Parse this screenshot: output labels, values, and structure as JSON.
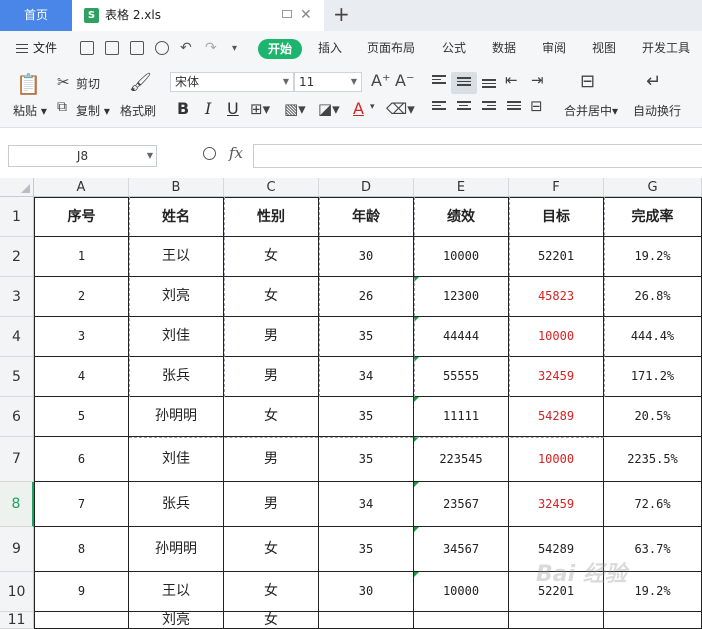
{
  "tabs": {
    "home": "首页",
    "file_name": "表格 2.xls",
    "file_icon": "S",
    "add": "+"
  },
  "menu": {
    "file": "文件",
    "items": [
      "开始",
      "插入",
      "页面布局",
      "公式",
      "数据",
      "审阅",
      "视图",
      "开发工具"
    ],
    "active_index": 0
  },
  "ribbon": {
    "paste": "粘贴",
    "cut": "剪切",
    "copy": "复制",
    "format_painter": "格式刷",
    "font_name": "宋体",
    "font_size": "11",
    "merge_center": "合并居中",
    "auto_wrap": "自动换行",
    "bold": "B",
    "italic": "I",
    "underline": "U",
    "font_color_glyph": "A"
  },
  "formula_bar": {
    "cell_ref": "J8",
    "fx": "fx",
    "value": ""
  },
  "grid": {
    "columns": [
      "A",
      "B",
      "C",
      "D",
      "E",
      "F",
      "G"
    ],
    "row_numbers": [
      "1",
      "2",
      "3",
      "4",
      "5",
      "6",
      "7",
      "8",
      "9",
      "10",
      "11"
    ],
    "selected_row": "8",
    "header_row": [
      "序号",
      "姓名",
      "性别",
      "年龄",
      "绩效",
      "目标",
      "完成率"
    ],
    "rows": [
      [
        "1",
        "王以",
        "女",
        "30",
        "10000",
        "52201",
        "19.2%"
      ],
      [
        "2",
        "刘亮",
        "女",
        "26",
        "12300",
        "45823",
        "26.8%"
      ],
      [
        "3",
        "刘佳",
        "男",
        "35",
        "44444",
        "10000",
        "444.4%"
      ],
      [
        "4",
        "张兵",
        "男",
        "34",
        "55555",
        "32459",
        "171.2%"
      ],
      [
        "5",
        "孙明明",
        "女",
        "35",
        "11111",
        "54289",
        "20.5%"
      ],
      [
        "6",
        "刘佳",
        "男",
        "35",
        "223545",
        "10000",
        "2235.5%"
      ],
      [
        "7",
        "张兵",
        "男",
        "34",
        "23567",
        "32459",
        "72.6%"
      ],
      [
        "8",
        "孙明明",
        "女",
        "35",
        "34567",
        "54289",
        "63.7%"
      ],
      [
        "9",
        "王以",
        "女",
        "30",
        "10000",
        "52201",
        "19.2%"
      ],
      [
        "",
        "刘亮",
        "女",
        "",
        "",
        "",
        ""
      ]
    ],
    "red_target_rows": [
      2,
      3,
      4,
      5,
      6,
      7
    ],
    "green_marker_rows": [
      2,
      3,
      4,
      5,
      6,
      7,
      8,
      9
    ]
  },
  "colors": {
    "accent_green": "#1db46e",
    "tab_blue": "#4a86e8",
    "red_text": "#d62323"
  },
  "watermark": "Bai 经验"
}
